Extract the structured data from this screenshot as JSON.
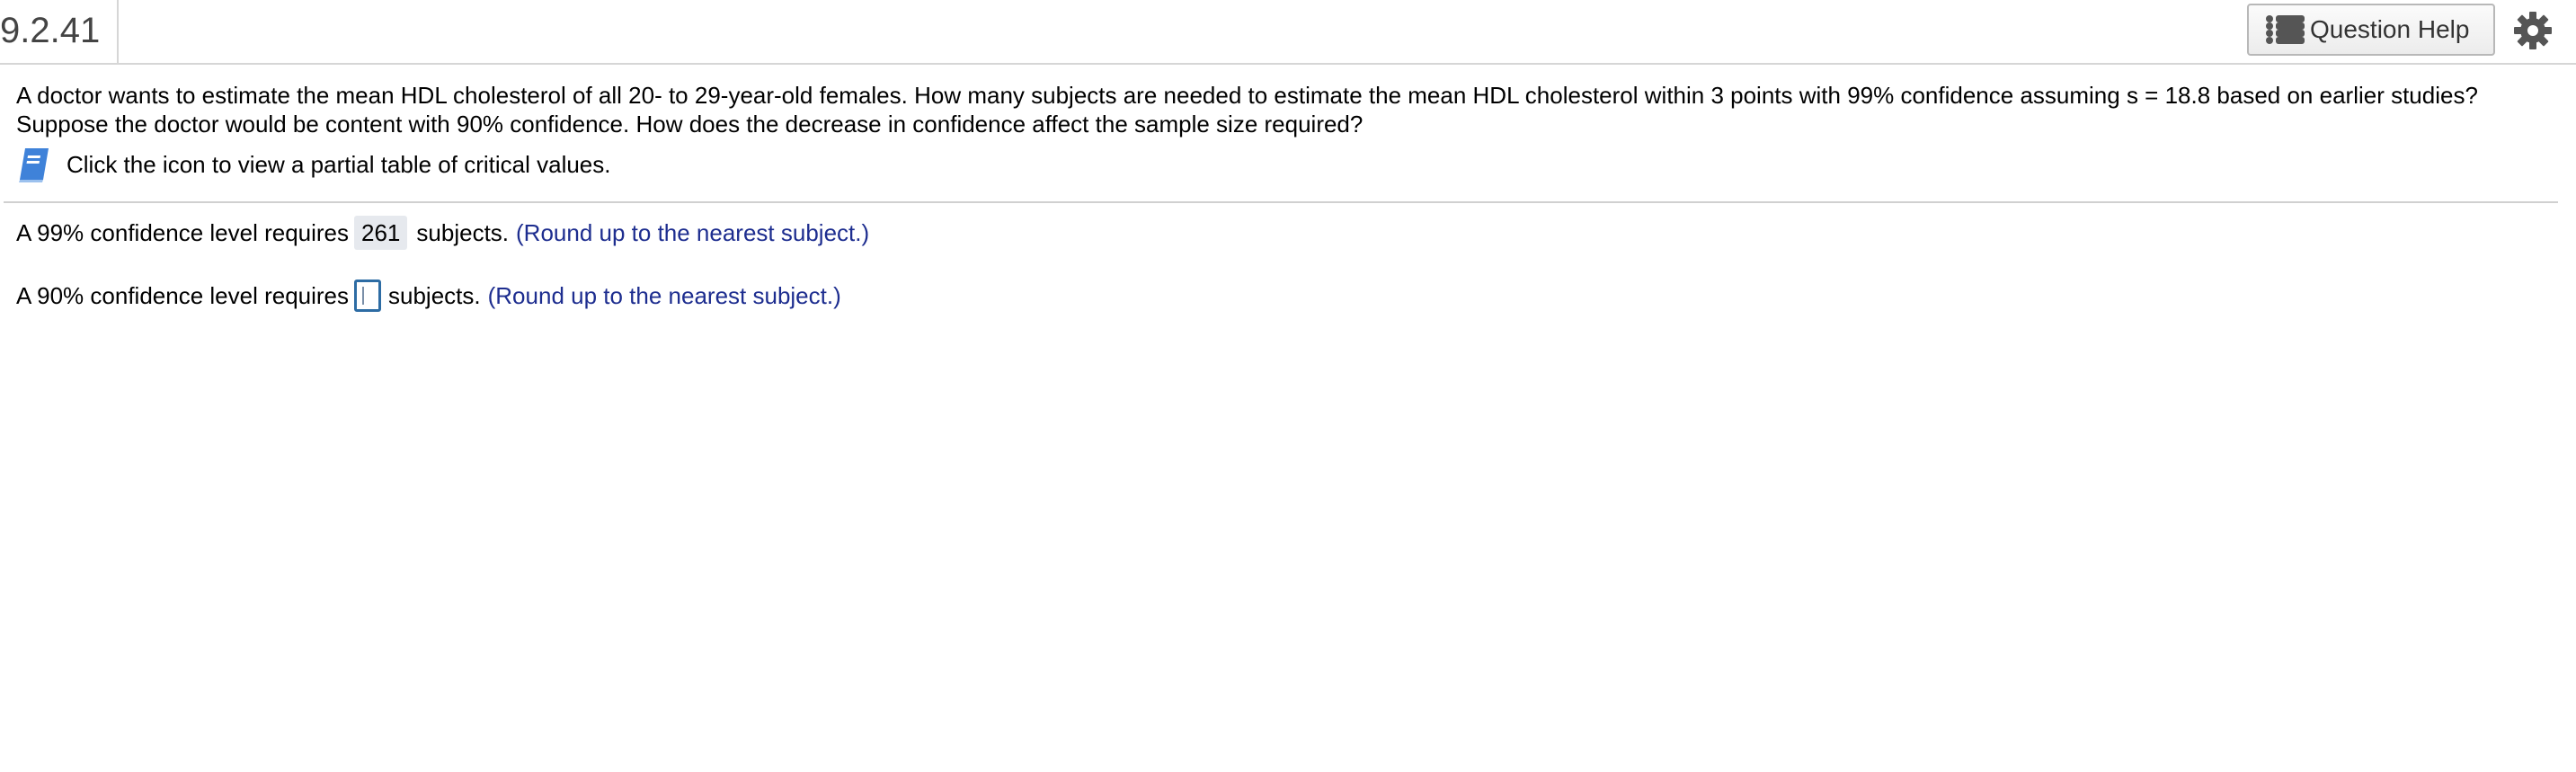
{
  "header": {
    "question_number": "9.2.41",
    "help_button_label": "Question Help"
  },
  "question": {
    "line1": "A doctor wants to estimate the mean HDL cholesterol of all 20- to 29-year-old females. How many subjects are needed to estimate the mean HDL cholesterol within 3 points with 99% confidence assuming s = 18.8 based on earlier studies?",
    "line2": "Suppose the doctor would be content with 90% confidence. How does the decrease in confidence affect the sample size required?",
    "hint_text": "Click the icon to view a partial table of critical values."
  },
  "answers": [
    {
      "prefix": "A 99% confidence level requires",
      "value": "261",
      "suffix": "subjects.",
      "note": "(Round up to the nearest subject.)"
    },
    {
      "prefix": "A 90% confidence level requires",
      "value": "",
      "suffix": "subjects.",
      "note": "(Round up to the nearest subject.)"
    }
  ],
  "icons": {
    "help": "list-icon",
    "settings": "gear-icon",
    "reference": "book-icon"
  },
  "colors": {
    "note_text": "#1d2d8f",
    "input_border": "#2d6ca4",
    "filled_bg": "#e6e9ee",
    "book_icon": "#3f82d9"
  }
}
